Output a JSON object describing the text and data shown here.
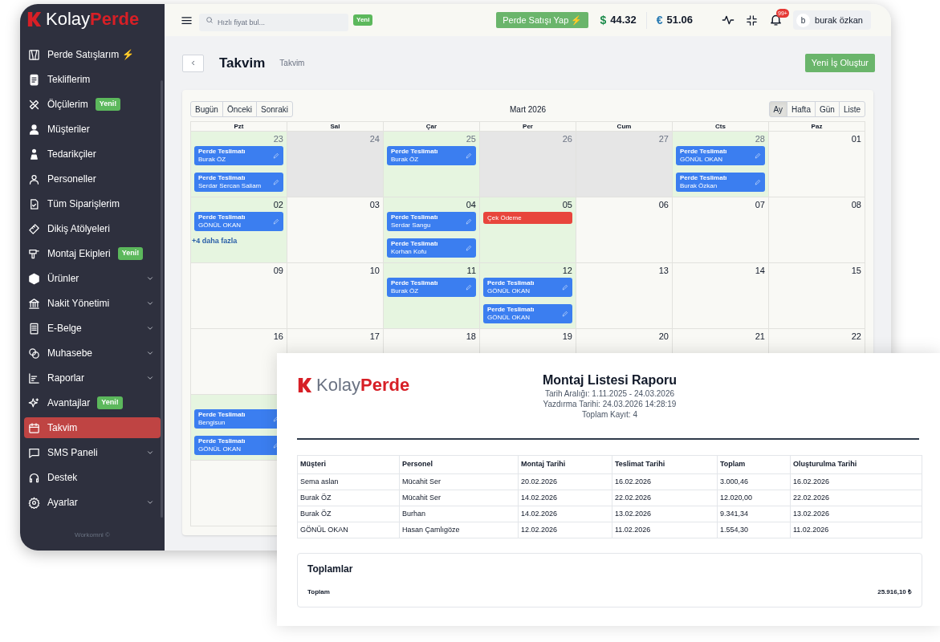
{
  "sidebar": {
    "logo": {
      "part_1": "Kolay",
      "part_2": "Perde"
    },
    "items": [
      {
        "label": "Perde Satışlarım ⚡",
        "selected": false,
        "expandable": false
      },
      {
        "label": "Tekliflerim",
        "selected": false,
        "expandable": false
      },
      {
        "label": "Ölçülerim",
        "badge": "Yeni!",
        "selected": false,
        "expandable": false
      },
      {
        "label": "Müşteriler",
        "selected": false,
        "expandable": false
      },
      {
        "label": "Tedarikçiler",
        "selected": false,
        "expandable": false
      },
      {
        "label": "Personeller",
        "selected": false,
        "expandable": false
      },
      {
        "label": "Tüm Siparişlerim",
        "selected": false,
        "expandable": false
      },
      {
        "label": "Dikiş Atölyeleri",
        "selected": false,
        "expandable": false
      },
      {
        "label": "Montaj Ekipleri",
        "badge": "Yeni!",
        "selected": false,
        "expandable": false
      },
      {
        "label": "Ürünler",
        "expandable": true,
        "selected": false
      },
      {
        "label": "Nakit Yönetimi",
        "expandable": true,
        "selected": false
      },
      {
        "label": "E-Belge",
        "expandable": true,
        "selected": false
      },
      {
        "label": "Muhasebe",
        "expandable": true,
        "selected": false
      },
      {
        "label": "Raporlar",
        "expandable": true,
        "selected": false
      },
      {
        "label": "Avantajlar",
        "badge": "Yeni!",
        "selected": false,
        "expandable": false
      },
      {
        "label": "Takvim",
        "selected": true,
        "expandable": false
      },
      {
        "label": "SMS Paneli",
        "expandable": true,
        "selected": false
      },
      {
        "label": "Destek",
        "selected": false,
        "expandable": false
      },
      {
        "label": "Ayarlar",
        "expandable": true,
        "selected": false
      }
    ],
    "footer": "Workomni ©"
  },
  "header": {
    "search": {
      "placeholder": "Hızlı fiyat bul..."
    },
    "search_badge": "Yeni",
    "sale_button": "Perde Satışı Yap ⚡",
    "rates": [
      {
        "symbol": "$",
        "value": "44.32"
      },
      {
        "symbol": "€",
        "value": "51.06"
      }
    ],
    "notification_count": "99+",
    "avatar": "b",
    "user": "burak özkan"
  },
  "page": {
    "title": "Takvim",
    "breadcrumb": "Takvim",
    "new_button": "Yeni İş Oluştur"
  },
  "calendar": {
    "nav_buttons": [
      "Bugün",
      "Önceki",
      "Sonraki"
    ],
    "title": "Mart 2026",
    "views": [
      {
        "label": "Ay",
        "selected": true
      },
      {
        "label": "Hafta",
        "selected": false
      },
      {
        "label": "Gün",
        "selected": false
      },
      {
        "label": "Liste",
        "selected": false
      }
    ],
    "weekdays": [
      "Pzt",
      "Sal",
      "Çar",
      "Per",
      "Cum",
      "Cts",
      "Paz"
    ],
    "weeks": [
      {
        "days": [
          {
            "date": "23",
            "muted": true,
            "highlighted": true,
            "greyed": false,
            "events": [
              {
                "kind": "delivery",
                "title": "Perde Teslimatı",
                "name": "Burak ÖZ"
              },
              {
                "kind": "delivery",
                "title": "Perde Teslimatı",
                "name": "Serdar Sercan Saliam"
              }
            ]
          },
          {
            "date": "24",
            "muted": true,
            "highlighted": false,
            "greyed": true
          },
          {
            "date": "25",
            "muted": true,
            "highlighted": true,
            "greyed": false,
            "events": [
              {
                "kind": "delivery",
                "title": "Perde Teslimatı",
                "name": "Burak ÖZ"
              }
            ]
          },
          {
            "date": "26",
            "muted": true,
            "highlighted": false,
            "greyed": true
          },
          {
            "date": "27",
            "muted": true,
            "highlighted": false,
            "greyed": true
          },
          {
            "date": "28",
            "muted": true,
            "highlighted": true,
            "greyed": false,
            "events": [
              {
                "kind": "delivery",
                "title": "Perde Teslimatı",
                "name": "GÖNÜL OKAN"
              },
              {
                "kind": "delivery",
                "title": "Perde Teslimatı",
                "name": "Burak Özkan"
              }
            ]
          },
          {
            "date": "01",
            "muted": false,
            "highlighted": false,
            "greyed": false
          }
        ]
      },
      {
        "days": [
          {
            "date": "02",
            "muted": false,
            "highlighted": true,
            "greyed": false,
            "events": [
              {
                "kind": "delivery",
                "title": "Perde Teslimatı",
                "name": "GÖNÜL OKAN"
              }
            ],
            "more": "+4 daha fazla"
          },
          {
            "date": "03",
            "muted": false,
            "highlighted": false,
            "greyed": false
          },
          {
            "date": "04",
            "muted": false,
            "highlighted": true,
            "greyed": false,
            "events": [
              {
                "kind": "delivery",
                "title": "Perde Teslimatı",
                "name": "Serdar Sangu"
              },
              {
                "kind": "delivery",
                "title": "Perde Teslimatı",
                "name": "Korhan Kofu"
              }
            ]
          },
          {
            "date": "05",
            "muted": false,
            "highlighted": true,
            "greyed": false,
            "events": [
              {
                "kind": "payment",
                "title": "Çek Ödeme"
              }
            ]
          },
          {
            "date": "06",
            "muted": false,
            "highlighted": false,
            "greyed": false
          },
          {
            "date": "07",
            "muted": false,
            "highlighted": false,
            "greyed": false
          },
          {
            "date": "08",
            "muted": false,
            "highlighted": false,
            "greyed": false
          }
        ]
      },
      {
        "days": [
          {
            "date": "09",
            "muted": false,
            "highlighted": false,
            "greyed": false
          },
          {
            "date": "10",
            "muted": false,
            "highlighted": false,
            "greyed": false
          },
          {
            "date": "11",
            "muted": false,
            "highlighted": true,
            "greyed": false,
            "events": [
              {
                "kind": "delivery",
                "title": "Perde Teslimatı",
                "name": "Burak ÖZ"
              }
            ]
          },
          {
            "date": "12",
            "muted": false,
            "highlighted": true,
            "greyed": false,
            "events": [
              {
                "kind": "delivery",
                "title": "Perde Teslimatı",
                "name": "GÖNÜL OKAN"
              },
              {
                "kind": "delivery",
                "title": "Perde Teslimatı",
                "name": "GÖNÜL OKAN"
              }
            ]
          },
          {
            "date": "13",
            "muted": false,
            "highlighted": false,
            "greyed": false
          },
          {
            "date": "14",
            "muted": false,
            "highlighted": false,
            "greyed": false
          },
          {
            "date": "15",
            "muted": false,
            "highlighted": false,
            "greyed": false
          }
        ]
      },
      {
        "days": [
          {
            "date": "16",
            "muted": false,
            "highlighted": false,
            "greyed": false
          },
          {
            "date": "17",
            "muted": false,
            "highlighted": false,
            "greyed": false
          },
          {
            "date": "18",
            "muted": false,
            "highlighted": false,
            "greyed": false
          },
          {
            "date": "19",
            "muted": false,
            "highlighted": false,
            "greyed": false
          },
          {
            "date": "20",
            "muted": false,
            "highlighted": false,
            "greyed": false
          },
          {
            "date": "21",
            "muted": false,
            "highlighted": false,
            "greyed": false
          },
          {
            "date": "22",
            "muted": false,
            "highlighted": false,
            "greyed": false
          }
        ]
      },
      {
        "days": [
          {
            "highlighted": true,
            "greyed": false,
            "events": [
              {
                "kind": "delivery",
                "title": "Perde Teslimatı",
                "name": "Bengisun"
              },
              {
                "kind": "delivery",
                "title": "Perde Teslimatı",
                "name": "GÖNÜL OKAN"
              }
            ]
          }
        ]
      }
    ]
  },
  "report": {
    "logo": {
      "part_1": "Kolay",
      "part_2": "Perde"
    },
    "title": "Montaj Listesi Raporu",
    "meta": [
      "Tarih Aralığı: 1.11.2025 - 24.03.2026",
      "Yazdırma Tarihi: 24.03.2026 14:28:19",
      "Toplam Kayıt: 4"
    ],
    "table": {
      "columns": [
        "Müşteri",
        "Personel",
        "Montaj Tarihi",
        "Teslimat Tarihi",
        "Toplam",
        "Oluşturulma Tarihi"
      ],
      "rows": [
        [
          "Sema aslan",
          "Mücahit Ser",
          "20.02.2026",
          "16.02.2026",
          "3.000,46",
          "16.02.2026"
        ],
        [
          "Burak ÖZ",
          "Mücahit Ser",
          "14.02.2026",
          "22.02.2026",
          "12.020,00",
          "22.02.2026"
        ],
        [
          "Burak ÖZ",
          "Burhan",
          "14.02.2026",
          "13.02.2026",
          "9.341,34",
          "13.02.2026"
        ],
        [
          "GÖNÜL OKAN",
          "Hasan Çamlıgöze",
          "12.02.2026",
          "11.02.2026",
          "1.554,30",
          "11.02.2026"
        ]
      ]
    },
    "totals": {
      "title": "Toplamlar",
      "label": "Toplam",
      "value": "25.916,10 ₺"
    }
  }
}
